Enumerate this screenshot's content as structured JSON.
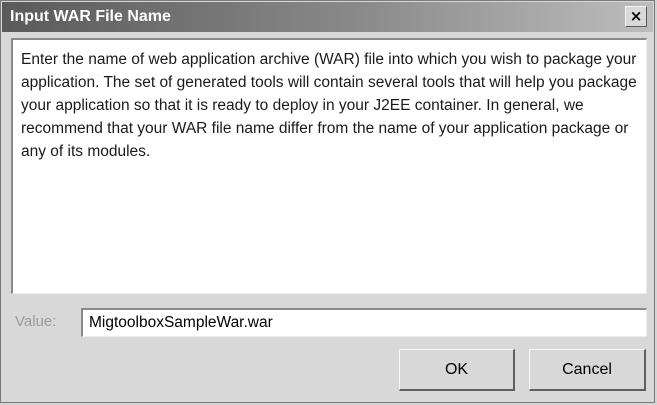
{
  "window": {
    "title": "Input WAR File Name",
    "close_glyph": "×",
    "close_icon": "close-icon"
  },
  "message": {
    "text": "Enter the name of web application archive (WAR) file into which you wish to package your application.  The set of generated tools will contain several tools that will help you package your application so that it is ready to deploy in your J2EE container.  In general, we recommend that your WAR file name differ from the name of your application package or any of its modules."
  },
  "value_field": {
    "label": "Value:",
    "value": "MigtoolboxSampleWar.war"
  },
  "buttons": {
    "ok_label": "OK",
    "cancel_label": "Cancel"
  },
  "colors": {
    "title_bar_start": "#5a5a5a",
    "title_bar_end": "#bdbdbd",
    "dialog_background": "#d8d8d8",
    "label_disabled": "#9a9a9a"
  }
}
